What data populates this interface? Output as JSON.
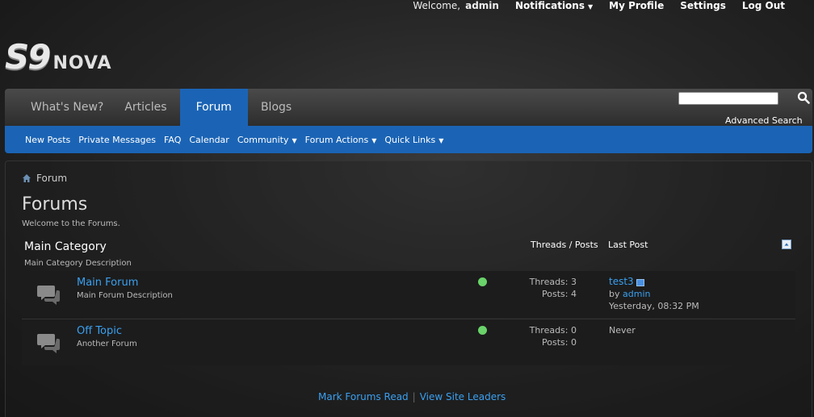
{
  "topbar": {
    "welcome": "Welcome,",
    "username": "admin",
    "notifications": "Notifications",
    "my_profile": "My Profile",
    "settings": "Settings",
    "logout": "Log Out"
  },
  "logo": {
    "big": "S9",
    "small": "NOVA"
  },
  "nav": {
    "tabs": [
      {
        "label": "What's New?"
      },
      {
        "label": "Articles"
      },
      {
        "label": "Forum"
      },
      {
        "label": "Blogs"
      }
    ],
    "active_tab": "Forum",
    "sub": [
      {
        "label": "New Posts"
      },
      {
        "label": "Private Messages"
      },
      {
        "label": "FAQ"
      },
      {
        "label": "Calendar"
      },
      {
        "label": "Community"
      },
      {
        "label": "Forum Actions"
      },
      {
        "label": "Quick Links"
      }
    ]
  },
  "search": {
    "value": "",
    "advanced": "Advanced Search"
  },
  "breadcrumb": {
    "label": "Forum"
  },
  "page": {
    "title": "Forums",
    "description": "Welcome to the Forums."
  },
  "category": {
    "title": "Main Category",
    "description": "Main Category Description",
    "col_threads": "Threads / Posts",
    "col_last": "Last Post"
  },
  "forums": [
    {
      "name": "Main Forum",
      "description": "Main Forum Description",
      "threads": "Threads: 3",
      "posts": "Posts: 4",
      "last_title": "test3",
      "last_by_prefix": "by",
      "last_by": "admin",
      "last_time": "Yesterday, 08:32 PM"
    },
    {
      "name": "Off Topic",
      "description": "Another Forum",
      "threads": "Threads: 0",
      "posts": "Posts: 0",
      "last_title": "Never"
    }
  ],
  "footer": {
    "mark_read": "Mark Forums Read",
    "sep": "|",
    "site_leaders": "View Site Leaders"
  },
  "colors": {
    "accent": "#1b64b5",
    "link": "#3aa0f0",
    "status_ok": "#6ad36a"
  }
}
